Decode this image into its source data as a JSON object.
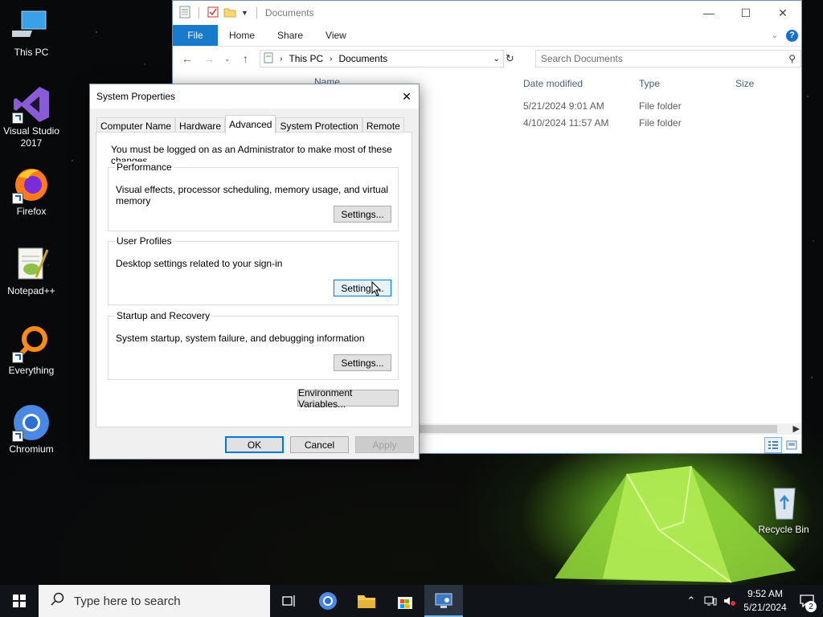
{
  "desktop": {
    "icons": [
      {
        "label": "This PC"
      },
      {
        "label": "Visual Studio 2017"
      },
      {
        "label": "Firefox"
      },
      {
        "label": "Notepad++"
      },
      {
        "label": "Everything"
      },
      {
        "label": "Chromium"
      },
      {
        "label": "Recycle Bin"
      }
    ]
  },
  "explorer": {
    "title": "Documents",
    "ribbon_tabs": {
      "file": "File",
      "home": "Home",
      "share": "Share",
      "view": "View"
    },
    "breadcrumb": [
      "This PC",
      "Documents"
    ],
    "search_placeholder": "Search Documents",
    "columns": {
      "name": "Name",
      "date": "Date modified",
      "type": "Type",
      "size": "Size"
    },
    "rows": [
      {
        "date": "5/21/2024 9:01 AM",
        "type": "File folder"
      },
      {
        "date": "4/10/2024 11:57 AM",
        "type": "File folder"
      }
    ]
  },
  "dialog": {
    "title": "System Properties",
    "tabs": [
      "Computer Name",
      "Hardware",
      "Advanced",
      "System Protection",
      "Remote"
    ],
    "active_tab": "Advanced",
    "notice": "You must be logged on as an Administrator to make most of these changes.",
    "performance": {
      "legend": "Performance",
      "desc": "Visual effects, processor scheduling, memory usage, and virtual memory",
      "button": "Settings..."
    },
    "user_profiles": {
      "legend": "User Profiles",
      "desc": "Desktop settings related to your sign-in",
      "button": "Settings..."
    },
    "startup": {
      "legend": "Startup and Recovery",
      "desc": "System startup, system failure, and debugging information",
      "button": "Settings..."
    },
    "env_button": "Environment Variables...",
    "ok": "OK",
    "cancel": "Cancel",
    "apply": "Apply"
  },
  "taskbar": {
    "search_placeholder": "Type here to search",
    "time": "9:52 AM",
    "date": "5/21/2024",
    "notification_count": "2"
  },
  "colors": {
    "accent": "#0078d7",
    "file_tab": "#1979ca"
  }
}
